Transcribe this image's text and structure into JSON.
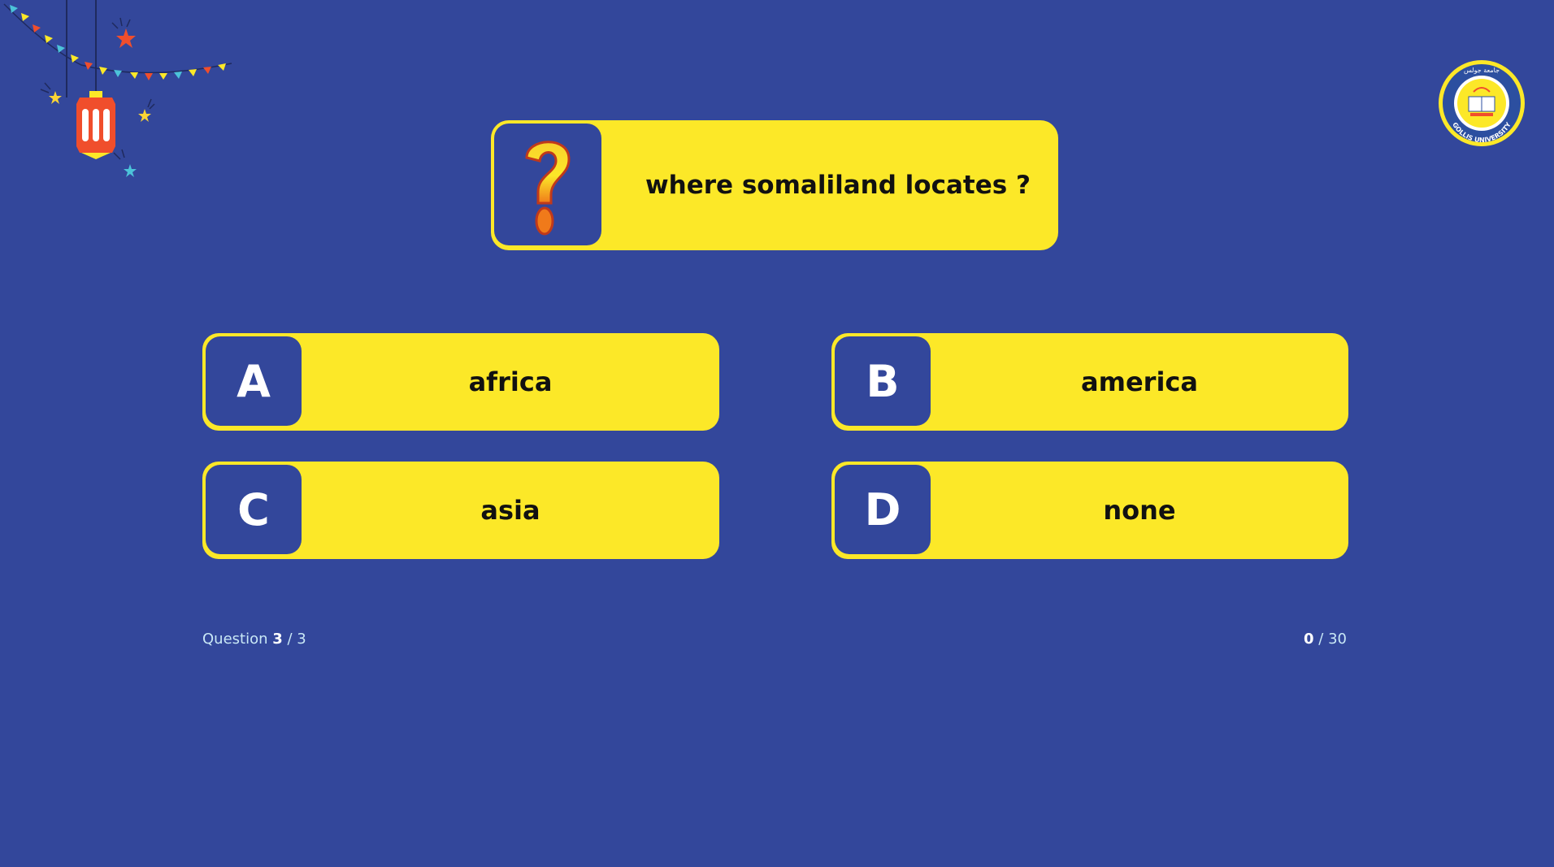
{
  "question": {
    "text": "where somaliland locates ?"
  },
  "answers": [
    {
      "letter": "A",
      "text": "africa"
    },
    {
      "letter": "B",
      "text": "america"
    },
    {
      "letter": "C",
      "text": "asia"
    },
    {
      "letter": "D",
      "text": "none"
    }
  ],
  "progress": {
    "label": "Question",
    "current": "3",
    "separator": " / ",
    "total": "3"
  },
  "score": {
    "current": "0",
    "separator": " / ",
    "total": "30"
  },
  "logo": {
    "name": "GOLLIS UNIVERSITY",
    "arabic": "جامعة جولس"
  },
  "colors": {
    "background": "#33479b",
    "card": "#fce828",
    "box": "#33479b"
  }
}
